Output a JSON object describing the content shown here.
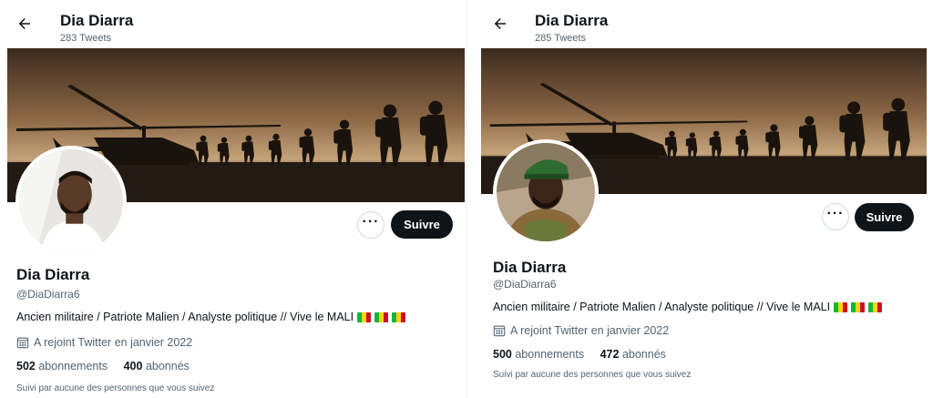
{
  "left": {
    "header": {
      "name": "Dia Diarra",
      "tweet_count": "283 Tweets"
    },
    "profile": {
      "name": "Dia Diarra",
      "handle": "@DiaDiarra6",
      "bio": "Ancien militaire / Patriote Malien / Analyste politique // Vive le MALI",
      "joined": "A rejoint Twitter en janvier 2022",
      "following_count": "502",
      "following_label": "abonnements",
      "followers_count": "400",
      "followers_label": "abonnés",
      "followed_by": "Suivi par aucune des personnes que vous suivez"
    },
    "actions": {
      "more_label": "···",
      "follow_label": "Suivre"
    }
  },
  "right": {
    "header": {
      "name": "Dia Diarra",
      "tweet_count": "285 Tweets"
    },
    "profile": {
      "name": "Dia Diarra",
      "handle": "@DiaDiarra6",
      "bio": "Ancien militaire / Patriote Malien / Analyste politique // Vive le MALI",
      "joined": "A rejoint Twitter en janvier 2022",
      "following_count": "500",
      "following_label": "abonnements",
      "followers_count": "472",
      "followers_label": "abonnés",
      "followed_by": "Suivi par aucune des personnes que vous suivez"
    },
    "actions": {
      "more_label": "···",
      "follow_label": "Suivre"
    }
  },
  "icons": {
    "back": "arrow-left-icon",
    "calendar": "calendar-icon",
    "flag": "mali-flag-icon",
    "more": "ellipsis-icon"
  },
  "colors": {
    "text_primary": "#0f1419",
    "text_secondary": "#536471",
    "follow_button": "#0f1419",
    "flag_green": "#14b53a",
    "flag_yellow": "#fcd116",
    "flag_red": "#ce1126"
  }
}
